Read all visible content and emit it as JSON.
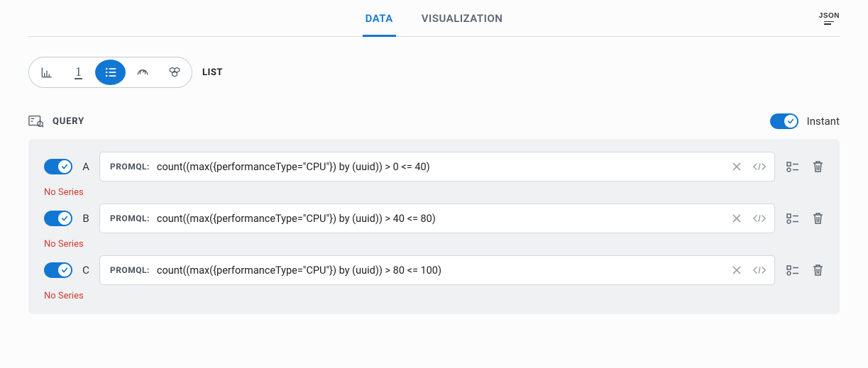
{
  "tabs": {
    "data": "DATA",
    "visualization": "VISUALIZATION"
  },
  "json_button": "JSON",
  "viewtype_label": "LIST",
  "query": {
    "label": "QUERY",
    "instant_label": "Instant",
    "instant_enabled": true
  },
  "promql_tag": "PROMQL:",
  "no_series": "No Series",
  "queries": [
    {
      "letter": "A",
      "enabled": true,
      "text": "count((max({performanceType=\"CPU\"}) by (uuid)) > 0 <= 40)"
    },
    {
      "letter": "B",
      "enabled": true,
      "text": "count((max({performanceType=\"CPU\"}) by (uuid)) > 40 <= 80)"
    },
    {
      "letter": "C",
      "enabled": true,
      "text": "count((max({performanceType=\"CPU\"}) by (uuid)) > 80 <= 100)"
    }
  ]
}
